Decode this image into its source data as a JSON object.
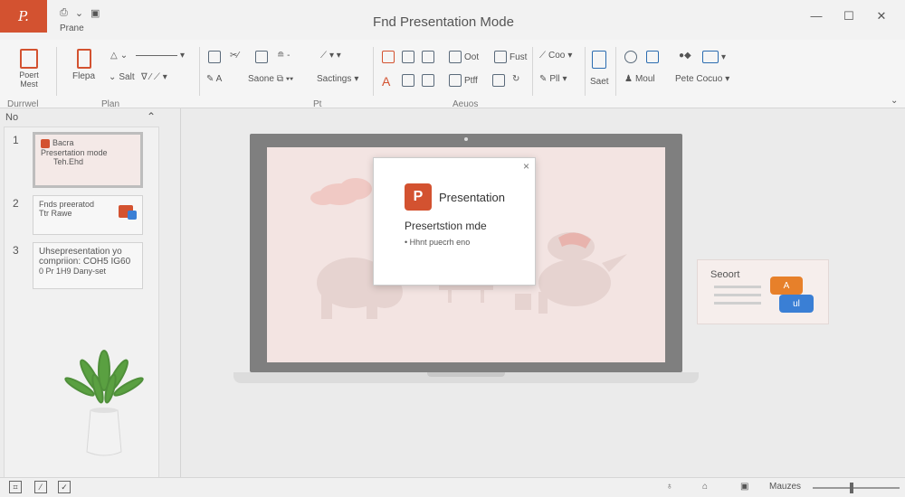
{
  "titlebar": {
    "app_icon": "P.",
    "qat_label": "Prane",
    "title": "Fnd Presentation Mode",
    "controls": [
      "—",
      "☐",
      "✕"
    ]
  },
  "ribbon": {
    "present_button": "Poert\nMest",
    "present_group": "Durrwel",
    "g2": {
      "item1": "Flepa",
      "item2": "Salt",
      "label": "Plan"
    },
    "g3": {
      "item1": "Saone",
      "item2": "Sactings",
      "label": "Pt"
    },
    "g4": {
      "item1": "Oot",
      "item2": "Fust",
      "item3": "Ptff",
      "label": "Aeuos"
    },
    "g5": {
      "item1": "Coo",
      "item2": "Pll",
      "item3": "Saet"
    },
    "g6": {
      "item1": "Moul",
      "item2": "Pete Cocuo"
    }
  },
  "left_pane": {
    "header": "No",
    "slides": [
      {
        "num": "1",
        "line1": "Bacra",
        "line2": "Presertation mode",
        "line3": "Teh.Ehd"
      },
      {
        "num": "2",
        "line1": "Fnds preeratod",
        "line2": "Ttr Rawe"
      },
      {
        "num": "3",
        "line1": "Uhsepresentation yo",
        "line2": "compriion: COH5 IG60",
        "line3": "0 Pr 1H9 Dany-set"
      }
    ]
  },
  "dialog": {
    "logo": "P",
    "app_name": "Presentation",
    "title": "Presertstion mde",
    "text": "• Hhnt puecrh eno",
    "close": "×"
  },
  "side_card": {
    "label": "Seoort",
    "bubble1": "A",
    "bubble2": "ul"
  },
  "statusbar": {
    "zoom_label": "Mauzes",
    "zoom_level": 0.45
  },
  "colors": {
    "accent": "#d35230",
    "blue": "#3a7fd5",
    "orange": "#e7802a"
  }
}
